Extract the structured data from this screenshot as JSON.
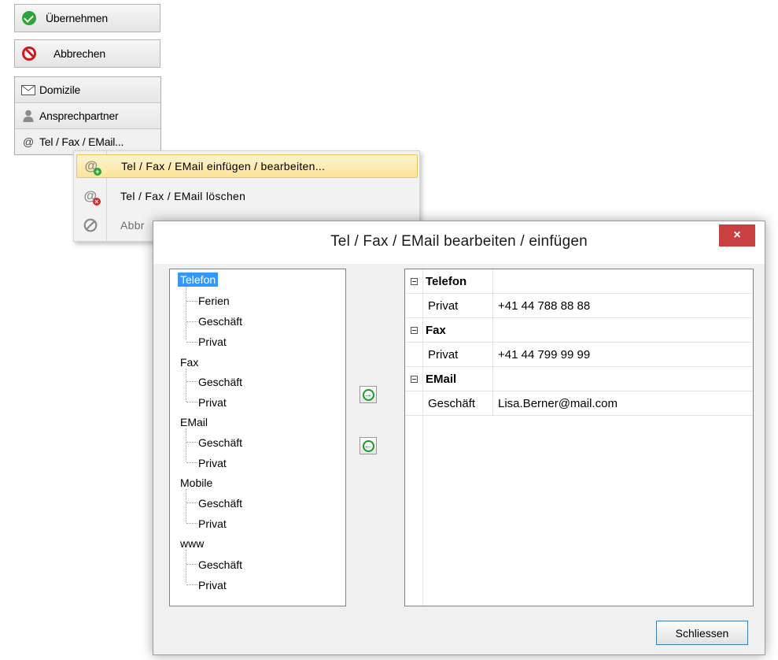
{
  "toolbar": {
    "apply_label": "Übernehmen",
    "cancel_label": "Abbrechen"
  },
  "nav": {
    "items": [
      {
        "label": "Domizile",
        "icon": "envelope-icon"
      },
      {
        "label": "Ansprechpartner",
        "icon": "person-icon"
      },
      {
        "label": "Tel / Fax / EMail...",
        "icon": "at-icon"
      }
    ]
  },
  "context_menu": {
    "items": [
      {
        "label": "Tel / Fax / EMail einfügen / bearbeiten...",
        "icon": "at-add-icon",
        "highlighted": true
      },
      {
        "label": "Tel / Fax / EMail löschen",
        "icon": "at-delete-icon"
      },
      {
        "label": "Abbr",
        "icon": "cancel-icon",
        "disabled": true
      }
    ]
  },
  "dialog": {
    "title": "Tel / Fax / EMail bearbeiten / einfügen",
    "close_glyph": "×",
    "tree": [
      {
        "label": "Telefon",
        "selected": true,
        "children": [
          "Ferien",
          "Geschäft",
          "Privat"
        ]
      },
      {
        "label": "Fax",
        "children": [
          "Geschäft",
          "Privat"
        ]
      },
      {
        "label": "EMail",
        "children": [
          "Geschäft",
          "Privat"
        ]
      },
      {
        "label": "Mobile",
        "children": [
          "Geschäft",
          "Privat"
        ]
      },
      {
        "label": "www",
        "children": [
          "Geschäft",
          "Privat"
        ]
      }
    ],
    "add_arrow_glyph": "→",
    "remove_arrow_glyph": "←",
    "grid": [
      {
        "group": "Telefon",
        "rows": [
          {
            "type": "Privat",
            "value": "+41 44 788 88 88"
          }
        ]
      },
      {
        "group": "Fax",
        "rows": [
          {
            "type": "Privat",
            "value": "+41 44 799 99 99"
          }
        ]
      },
      {
        "group": "EMail",
        "rows": [
          {
            "type": "Geschäft",
            "value": "Lisa.Berner@mail.com"
          }
        ]
      }
    ],
    "close_button_label": "Schliessen"
  },
  "colors": {
    "selection": "#3399ff",
    "menu_highlight": "#fbe49a",
    "close_red": "#c84040",
    "arrow_green": "#1c9b2b"
  }
}
